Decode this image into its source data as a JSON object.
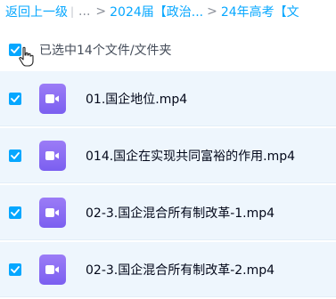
{
  "breadcrumb": {
    "back_label": "返回上一级",
    "separator": "|",
    "ellipsis": "...",
    "arrow": ">",
    "folder_1": "2024届【政治...",
    "folder_2": "24年高考【文"
  },
  "selection": {
    "label": "已选中14个文件/文件夹"
  },
  "files": [
    {
      "name": "01.国企地位.mp4",
      "icon": "video-file-icon"
    },
    {
      "name": "014.国企在实现共同富裕的作用.mp4",
      "icon": "video-file-icon"
    },
    {
      "name": "02-3.国企混合所有制改革-1.mp4",
      "icon": "video-file-icon"
    },
    {
      "name": "02-3.国企混合所有制改革-2.mp4",
      "icon": "video-file-icon"
    }
  ],
  "colors": {
    "accent": "#06a7ff",
    "row_selected_bg": "#eef6fd",
    "video_icon": "#8b6cf5"
  }
}
